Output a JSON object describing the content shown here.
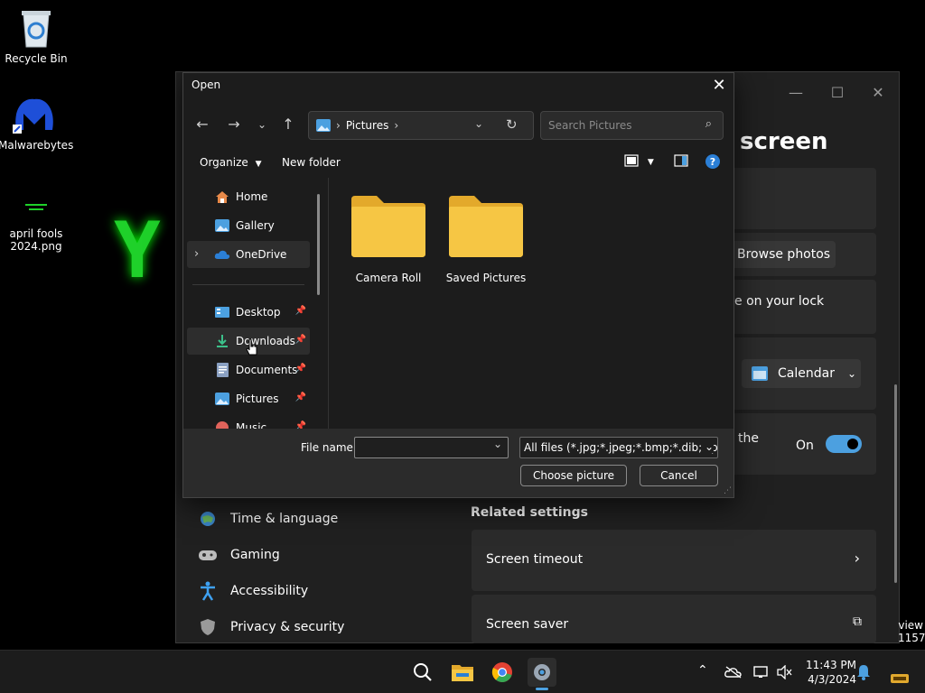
{
  "desktop": {
    "icons": [
      {
        "label": "Recycle Bin"
      },
      {
        "label": "Malwarebytes"
      },
      {
        "label": "april fools 2024.png"
      }
    ],
    "wallpaper_text": "Y"
  },
  "settings": {
    "title_partial": "screen",
    "browse_label": "Browse photos",
    "lock_text": "e on your lock",
    "calendar_label": "Calendar",
    "the_text": "the",
    "toggle_label": "On",
    "nav": [
      "Time & language",
      "Gaming",
      "Accessibility",
      "Privacy & security"
    ],
    "related_heading": "Related settings",
    "related": [
      "Screen timeout",
      "Screen saver"
    ],
    "edge_text": [
      "view",
      "1157"
    ]
  },
  "dialog": {
    "title": "Open",
    "address": {
      "location": "Pictures"
    },
    "search_placeholder": "Search Pictures",
    "toolbar": {
      "organize": "Organize",
      "new_folder": "New folder"
    },
    "tree": [
      {
        "label": "Home",
        "icon": "home-icon"
      },
      {
        "label": "Gallery",
        "icon": "gallery-icon"
      },
      {
        "label": "OneDrive",
        "icon": "onedrive-icon"
      },
      {
        "label": "Desktop",
        "icon": "desktop-icon"
      },
      {
        "label": "Downloads",
        "icon": "downloads-icon"
      },
      {
        "label": "Documents",
        "icon": "documents-icon"
      },
      {
        "label": "Pictures",
        "icon": "pictures-icon"
      },
      {
        "label": "Music",
        "icon": "music-icon"
      }
    ],
    "folders": [
      {
        "label": "Camera Roll"
      },
      {
        "label": "Saved Pictures"
      }
    ],
    "file_name_label": "File name:",
    "file_name_value": "",
    "file_type": "All files (*.jpg;*.jpeg;*.bmp;*.dib;*.png",
    "choose_label": "Choose picture",
    "cancel_label": "Cancel"
  },
  "taskbar": {
    "time": "11:43 PM",
    "date": "4/3/2024"
  },
  "colors": {
    "accent": "#4ca0e0",
    "folder": "#f6c644"
  }
}
